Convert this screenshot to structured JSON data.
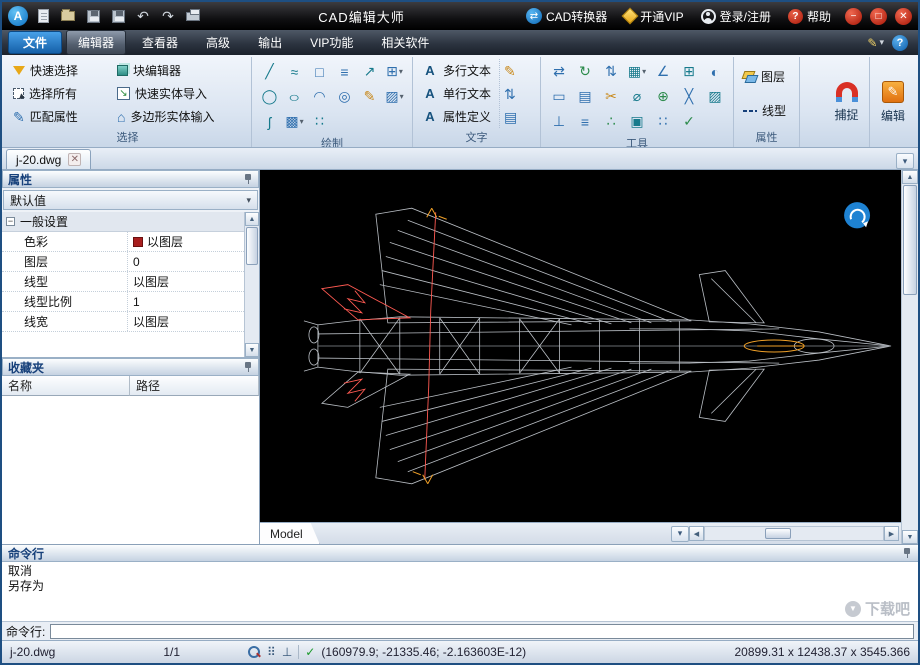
{
  "icons": {
    "logo": "A",
    "undo": "↶",
    "redo": "↷",
    "swap": "⇄",
    "qmark": "?",
    "minimize": "−",
    "maximize": "□",
    "close": "✕",
    "dropdown": "▾",
    "pencil": "✎",
    "check": "✓",
    "up": "▲",
    "down": "▼",
    "left": "◀",
    "right": "▶",
    "expand_minus": "−",
    "ortho": "⊥",
    "dots": "⠿",
    "line": "╱",
    "wave": "≈",
    "square": "□",
    "mline": "≡",
    "ray": "↗",
    "grid": "⊞",
    "circle": "◯",
    "ellipse": "○",
    "arc": "◠",
    "donut": "◎",
    "hatch": "▨",
    "spline": "ʃ",
    "gradient": "▩",
    "points": "∷",
    "textA": "A",
    "move": "⇄",
    "rotate": "↻",
    "stretch": "⇅",
    "array": "▦",
    "angle": "∠",
    "rect": "▭",
    "align": "▤",
    "trim": "✂",
    "diameter": "⌀",
    "join": "⊕",
    "erase": "╳",
    "mirror": "◐",
    "marks": "∴",
    "box": "▣",
    "house": "⌂",
    "se": "↘"
  },
  "titlebar": {
    "title": "CAD编辑大师",
    "converter": "CAD转换器",
    "vip": "开通VIP",
    "login": "登录/注册",
    "help": "帮助"
  },
  "menubar": {
    "file": "文件",
    "tabs": [
      "编辑器",
      "查看器",
      "高级",
      "输出",
      "VIP功能",
      "相关软件"
    ]
  },
  "ribbon": {
    "select_group": {
      "quick_select": "快速选择",
      "select_all": "选择所有",
      "match_props": "匹配属性",
      "block_editor": "块编辑器",
      "quick_import": "快速实体导入",
      "polygon_import": "多边形实体输入",
      "label": "选择"
    },
    "draw_label": "绘制",
    "text_group": {
      "multiline": "多行文本",
      "singleline": "单行文本",
      "attrdef": "属性定义",
      "label": "文字"
    },
    "tools_label": "工具",
    "props_group": {
      "layer": "图层",
      "linetype": "线型",
      "label": "属性"
    },
    "snap": "捕捉",
    "edit": "编辑"
  },
  "tabbar": {
    "doc_tab": "j-20.dwg"
  },
  "panel": {
    "properties_title": "属性",
    "preset": "默认值",
    "group_row": "一般设置",
    "rows": [
      {
        "label": "色彩",
        "value": "以图层"
      },
      {
        "label": "图层",
        "value": "0"
      },
      {
        "label": "线型",
        "value": "以图层"
      },
      {
        "label": "线型比例",
        "value": "1"
      },
      {
        "label": "线宽",
        "value": "以图层"
      }
    ],
    "favorites_title": "收藏夹",
    "col_name": "名称",
    "col_path": "路径"
  },
  "canvas": {
    "model_tab": "Model"
  },
  "cmd": {
    "title": "命令行",
    "history": [
      "取消",
      "另存为"
    ],
    "prompt": "命令行:",
    "watermark": "下载吧"
  },
  "statusbar": {
    "doc": "j-20.dwg",
    "page": "1/1",
    "coords": "(160979.9; -21335.46; -2.163603E-12)",
    "extent": "20899.31 x 12438.37 x 3545.366"
  }
}
